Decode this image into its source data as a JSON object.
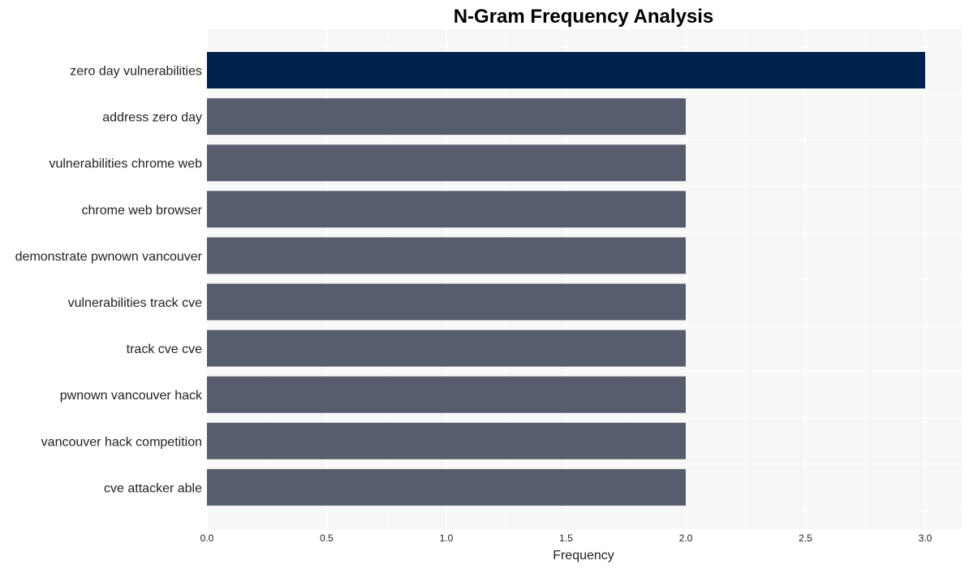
{
  "chart_data": {
    "type": "bar",
    "orientation": "horizontal",
    "title": "N-Gram Frequency Analysis",
    "xlabel": "Frequency",
    "ylabel": "",
    "categories": [
      "zero day vulnerabilities",
      "address zero day",
      "vulnerabilities chrome web",
      "chrome web browser",
      "demonstrate pwnown vancouver",
      "vulnerabilities track cve",
      "track cve cve",
      "pwnown vancouver hack",
      "vancouver hack competition",
      "cve attacker able"
    ],
    "values": [
      3,
      2,
      2,
      2,
      2,
      2,
      2,
      2,
      2,
      2
    ],
    "xlim": [
      0,
      3.15
    ],
    "xticks": [
      0.0,
      0.5,
      1.0,
      1.5,
      2.0,
      2.5,
      3.0
    ],
    "xtick_labels": [
      "0.0",
      "0.5",
      "1.0",
      "1.5",
      "2.0",
      "2.5",
      "3.0"
    ],
    "grid": true,
    "legend": "none",
    "colors": {
      "highlight": "#00224e",
      "default": "#575d6d",
      "plot_background": "#f7f7f7",
      "grid": "#ffffff"
    }
  }
}
